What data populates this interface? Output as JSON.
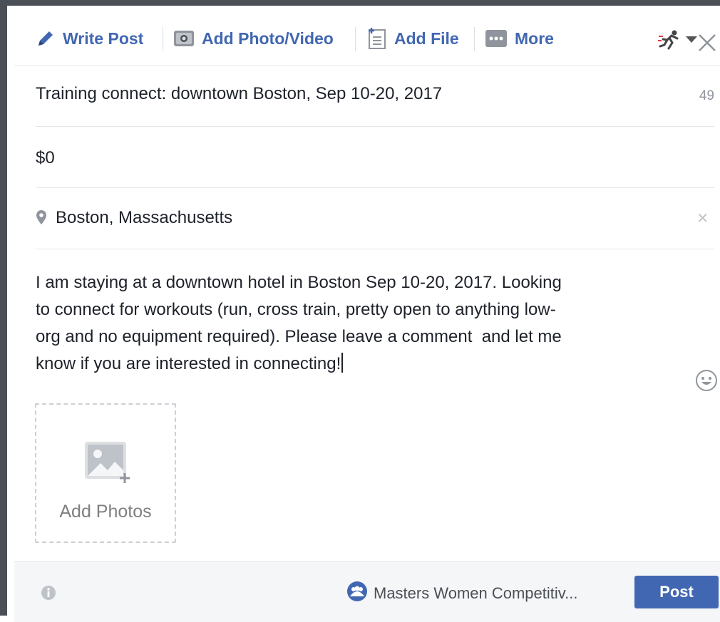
{
  "toolbar": {
    "write_post": "Write Post",
    "add_photo_video": "Add Photo/Video",
    "add_file": "Add File",
    "more": "More",
    "icons": [
      "pencil-icon",
      "camera-icon",
      "file-icon",
      "more-dots-icon",
      "runner-icon",
      "caret-down-icon",
      "close-icon"
    ]
  },
  "form": {
    "title": "Training connect: downtown Boston, Sep 10-20, 2017",
    "title_counter": "49",
    "price": "$0",
    "location": "Boston, Massachusetts",
    "description": "I am staying at a downtown hotel in Boston Sep 10-20, 2017. Looking\nto connect for workouts (run, cross train, pretty open to anything low-\norg and no equipment required). Please leave a comment  and let me\nknow if you are interested in connecting!"
  },
  "media": {
    "add_photos_label": "Add Photos"
  },
  "footer": {
    "audience": "Masters Women Competitiv...",
    "post_label": "Post"
  },
  "colors": {
    "brand_blue": "#4267b2",
    "frame_dark": "#4b4f56",
    "muted_text": "#90949c",
    "footer_bg": "#f5f6f7"
  }
}
